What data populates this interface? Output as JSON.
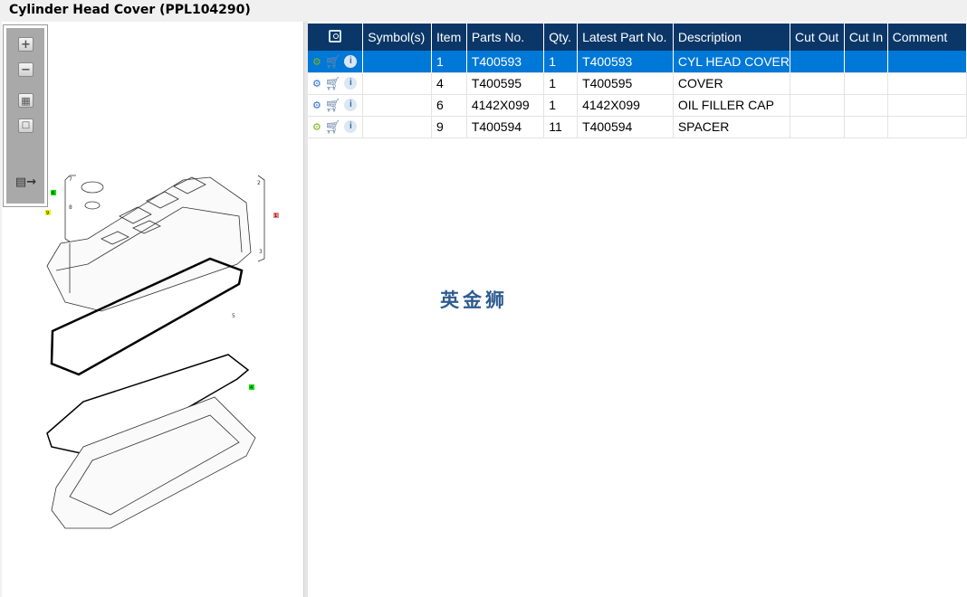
{
  "title": "Cylinder Head Cover (PPL104290)",
  "toolbar": {
    "buttons": [
      "zoom-in",
      "zoom-out",
      "fit-all",
      "fit-window",
      "export"
    ]
  },
  "table": {
    "headers": [
      "",
      "Symbol(s)",
      "Item",
      "Parts No.",
      "Qty.",
      "Latest Part No.",
      "Description",
      "Cut Out",
      "Cut In",
      "Comment"
    ],
    "rows": [
      {
        "item": "1",
        "part": "T400593",
        "qty": "1",
        "latest": "T400593",
        "desc": "CYL HEAD COVER",
        "selected": true
      },
      {
        "item": "4",
        "part": "T400595",
        "qty": "1",
        "latest": "T400595",
        "desc": "COVER"
      },
      {
        "item": "6",
        "part": "4142X099",
        "qty": "1",
        "latest": "4142X099",
        "desc": "OIL FILLER CAP"
      },
      {
        "item": "9",
        "part": "T400594",
        "qty": "11",
        "latest": "T400594",
        "desc": "SPACER"
      }
    ]
  },
  "diagram": {
    "callouts": [
      "2",
      "3",
      "5",
      "7",
      "8"
    ],
    "tags": [
      "6",
      "9",
      "1",
      "4"
    ]
  },
  "watermark": "英金狮"
}
